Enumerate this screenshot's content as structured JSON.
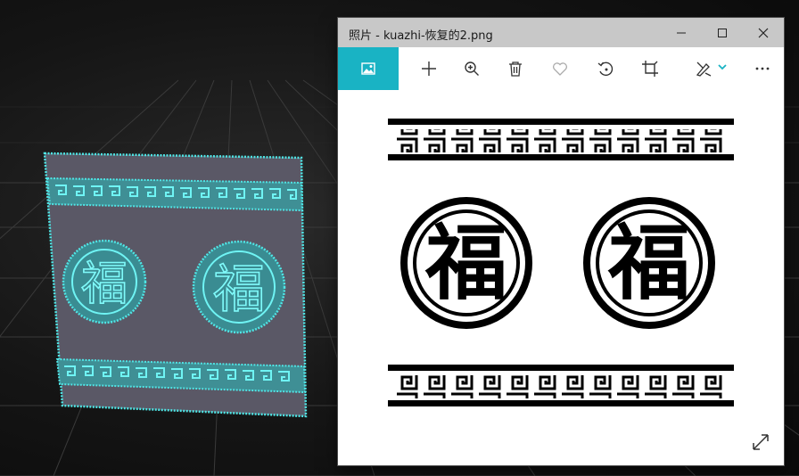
{
  "window": {
    "title": "照片 - kuazhi-恢复的2.png",
    "minimize_icon": "minimize-icon",
    "maximize_icon": "maximize-icon",
    "close_icon": "close-icon"
  },
  "toolbar": {
    "items": [
      "image-icon",
      "add-icon",
      "zoom-icon",
      "delete-icon",
      "favorite-icon",
      "rotate-icon",
      "crop-icon",
      "draw-icon",
      "more-icon"
    ],
    "accent": "#19b3c4"
  },
  "image": {
    "glyph": "福",
    "colors": {
      "ink": "#000000",
      "paper": "#ffffff"
    }
  },
  "viewport": {
    "mesh_color": "#4fe6e6",
    "glyph": "福"
  },
  "expand_icon": "expand-icon"
}
